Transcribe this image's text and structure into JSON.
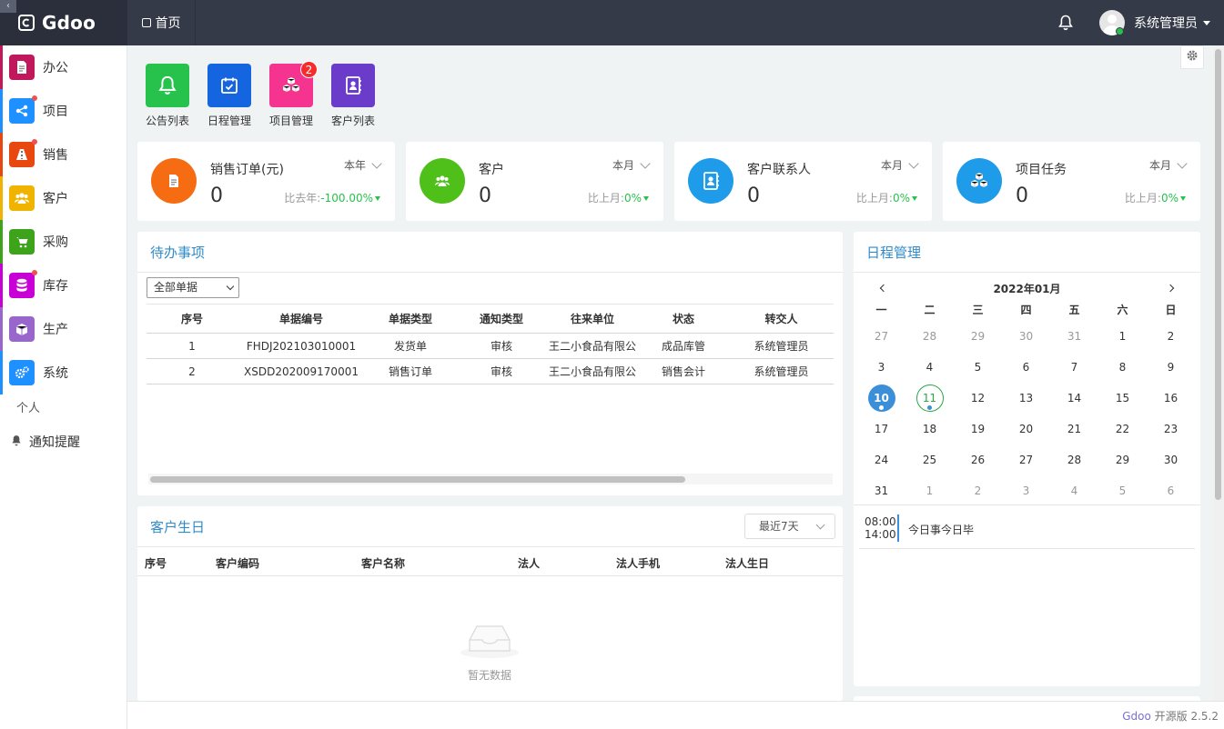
{
  "header": {
    "brand": "Gdoo",
    "collapse": "‹",
    "home_tab": "首页",
    "user_name": "系统管理员"
  },
  "sidebar": {
    "items": [
      {
        "label": "办公",
        "color": "#c1185b",
        "bar": "#c1185b",
        "icon": "document-icon",
        "dot": false
      },
      {
        "label": "项目",
        "color": "#1e90ff",
        "bar": "#1e90ff",
        "icon": "share-icon",
        "dot": true
      },
      {
        "label": "销售",
        "color": "#e8470f",
        "bar": "#e8470f",
        "icon": "road-icon",
        "dot": true
      },
      {
        "label": "客户",
        "color": "#f0b400",
        "bar": "#f0b400",
        "icon": "users-icon",
        "dot": false
      },
      {
        "label": "采购",
        "color": "#3ca31b",
        "bar": "#3ca31b",
        "icon": "cart-icon",
        "dot": false
      },
      {
        "label": "库存",
        "color": "#c800d6",
        "bar": "#c800d6",
        "icon": "database-icon",
        "dot": true
      },
      {
        "label": "生产",
        "color": "#9966cc",
        "bar": "#9966cc",
        "icon": "cube-icon",
        "dot": false
      },
      {
        "label": "系统",
        "color": "#1e90ff",
        "bar": "#1e90ff",
        "icon": "cogs-icon",
        "dot": false
      }
    ],
    "personal": "个人",
    "notice": "通知提醒"
  },
  "quick_apps": [
    {
      "label": "公告列表",
      "color": "#27c24c",
      "icon": "bell-icon",
      "badge": ""
    },
    {
      "label": "日程管理",
      "color": "#1565e0",
      "icon": "calendar-check-icon",
      "badge": ""
    },
    {
      "label": "项目管理",
      "color": "#f4348f",
      "icon": "cubes-icon",
      "badge": "2"
    },
    {
      "label": "客户列表",
      "color": "#6a3cc9",
      "icon": "contacts-book-icon",
      "badge": ""
    }
  ],
  "stats": [
    {
      "title": "销售订单(元)",
      "value": "0",
      "period": "本年",
      "compare_label": "比去年:",
      "compare_value": "-100.00%",
      "color": "#f56c12",
      "icon": "document-icon"
    },
    {
      "title": "客户",
      "value": "0",
      "period": "本月",
      "compare_label": "比上月:",
      "compare_value": "0%",
      "color": "#4fc01a",
      "icon": "users-icon"
    },
    {
      "title": "客户联系人",
      "value": "0",
      "period": "本月",
      "compare_label": "比上月:",
      "compare_value": "0%",
      "color": "#1e9be9",
      "icon": "contacts-book-icon"
    },
    {
      "title": "项目任务",
      "value": "0",
      "period": "本月",
      "compare_label": "比上月:",
      "compare_value": "0%",
      "color": "#1e9be9",
      "icon": "cubes-icon"
    }
  ],
  "todo": {
    "title": "待办事项",
    "filter": "全部单据",
    "columns": [
      "序号",
      "单据编号",
      "单据类型",
      "通知类型",
      "往来单位",
      "状态",
      "转交人"
    ],
    "rows": [
      [
        "1",
        "FHDJ202103010001",
        "发货单",
        "审核",
        "王二小食品有限公",
        "成品库管",
        "系统管理员"
      ],
      [
        "2",
        "XSDD202009170001",
        "销售订单",
        "审核",
        "王二小食品有限公",
        "销售会计",
        "系统管理员"
      ]
    ]
  },
  "birthday": {
    "title": "客户生日",
    "range": "最近7天",
    "columns": [
      "序号",
      "客户编码",
      "客户名称",
      "法人",
      "法人手机",
      "法人生日"
    ],
    "empty": "暂无数据"
  },
  "calendar": {
    "title": "日程管理",
    "month": "2022年01月",
    "weekdays": [
      "一",
      "二",
      "三",
      "四",
      "五",
      "六",
      "日"
    ],
    "weeks": [
      [
        "27",
        "28",
        "29",
        "30",
        "31",
        "1",
        "2"
      ],
      [
        "3",
        "4",
        "5",
        "6",
        "7",
        "8",
        "9"
      ],
      [
        "10",
        "11",
        "12",
        "13",
        "14",
        "15",
        "16"
      ],
      [
        "17",
        "18",
        "19",
        "20",
        "21",
        "22",
        "23"
      ],
      [
        "24",
        "25",
        "26",
        "27",
        "28",
        "29",
        "30"
      ],
      [
        "31",
        "1",
        "2",
        "3",
        "4",
        "5",
        "6"
      ]
    ],
    "event": {
      "start": "08:00",
      "end": "14:00",
      "title": "今日事今日毕"
    }
  },
  "footer": {
    "brand": "Gdoo",
    "version": "开源版 2.5.2"
  }
}
